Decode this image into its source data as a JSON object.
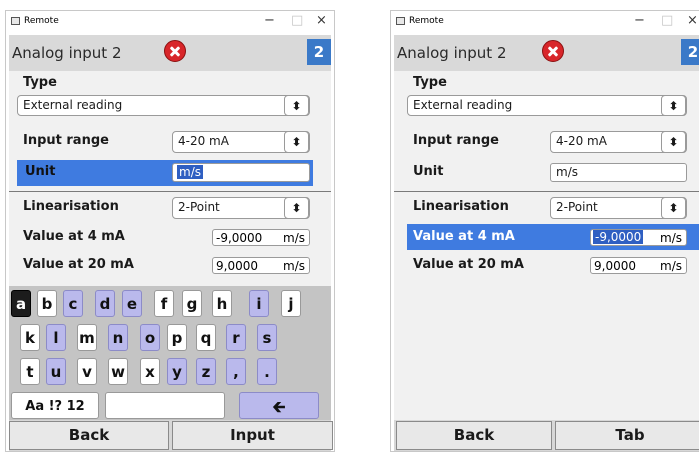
{
  "windows": [
    {
      "title": "Remote",
      "page_title": "Analog input 2",
      "page_number": "2",
      "type_label": "Type",
      "type_value": "External reading",
      "input_range_label": "Input range",
      "input_range_value": "4-20 mA",
      "unit_label": "Unit",
      "unit_value": "m/s",
      "linearisation_label": "Linearisation",
      "linearisation_value": "2-Point",
      "v4_label": "Value at 4 mA",
      "v4_value": "-9,0000",
      "v4_unit": "m/s",
      "v20_label": "Value at 20 mA",
      "v20_value": "9,0000",
      "v20_unit": "m/s",
      "left_button": "Back",
      "right_button": "Input"
    },
    {
      "title": "Remote",
      "page_title": "Analog input 2",
      "page_number": "2",
      "type_label": "Type",
      "type_value": "External reading",
      "input_range_label": "Input range",
      "input_range_value": "4-20 mA",
      "unit_label": "Unit",
      "unit_value": "m/s",
      "linearisation_label": "Linearisation",
      "linearisation_value": "2-Point",
      "v4_label": "Value at 4 mA",
      "v4_value": "-9,0000",
      "v4_unit": "m/s",
      "v20_label": "Value at 20 mA",
      "v20_value": "9,0000",
      "v20_unit": "m/s",
      "left_button": "Back",
      "right_button": "Tab"
    }
  ],
  "keyboard": {
    "row1": [
      "a",
      "b",
      "c",
      "d",
      "e",
      "f",
      "g",
      "h",
      "i",
      "j"
    ],
    "row2": [
      "k",
      "l",
      "m",
      "n",
      "o",
      "p",
      "q",
      "r",
      "s"
    ],
    "row3": [
      "t",
      "u",
      "v",
      "w",
      "x",
      "y",
      "z",
      ",",
      "."
    ],
    "mode_key": "Aa !? 12",
    "backspace": "🡰"
  },
  "icons": {
    "minimize": "−",
    "maximize": "□",
    "close": "×",
    "spinner": "⬍",
    "error": "error-icon"
  },
  "colors": {
    "highlight": "#3f7be0",
    "page_number_bg": "#3a79c8",
    "error_red": "#d8262a",
    "key_purple": "#bab9ec",
    "key_active": "#1c1c1c"
  }
}
